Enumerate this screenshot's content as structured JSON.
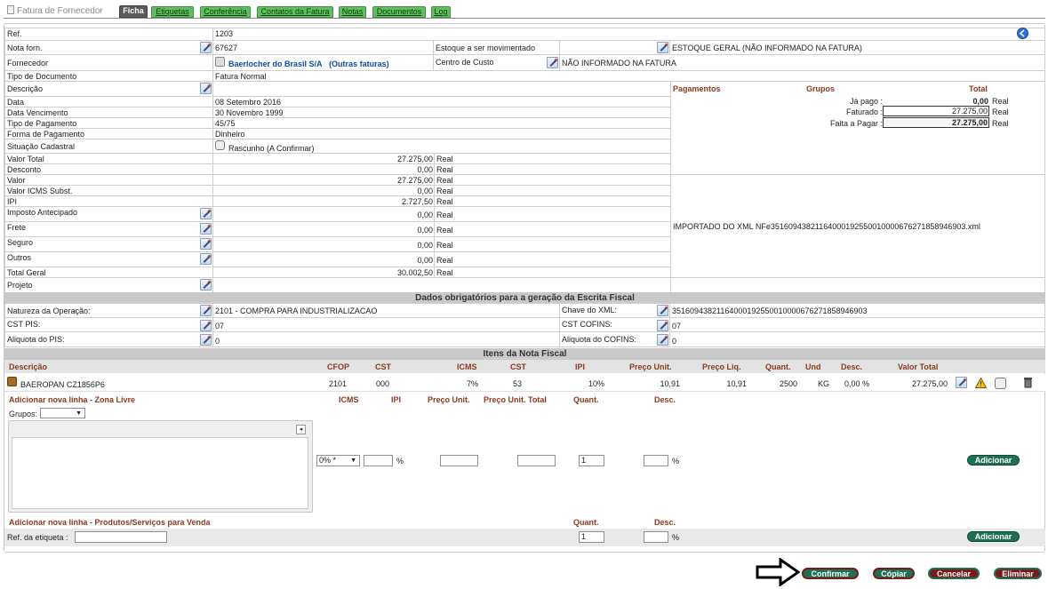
{
  "window": {
    "title": "Fatura de Fornecedor"
  },
  "tabs": [
    {
      "label": "Ficha"
    },
    {
      "label": "Etiquetas"
    },
    {
      "label": "Conferência"
    },
    {
      "label": "Contatos da Fatura"
    },
    {
      "label": "Notas"
    },
    {
      "label": "Documentos"
    },
    {
      "label": "Log"
    }
  ],
  "header": {
    "ref_label": "Ref.",
    "ref_value": "1203",
    "nota_label": "Nota forn.",
    "nota_value": "67627",
    "estoque_label": "Estoque a ser movimentado",
    "estoque_value": "ESTOQUE GERAL (NÃO INFORMADO NA FATURA)",
    "fornecedor_label": "Fornecedor",
    "fornecedor_value": "Baerlocher do Brasil S/A",
    "outras_faturas": "(Outras faturas)",
    "centro_label": "Centro de Custo",
    "centro_value": "NÃO INFORMADO NA FATURA",
    "tipo_doc_label": "Tipo de Documento",
    "tipo_doc_value": "Fatura Normal"
  },
  "details": {
    "descricao_label": "Descrição",
    "data_label": "Data",
    "data_value": "08 Setembro 2016",
    "venc_label": "Data Vencimento",
    "venc_value": "30 Novembro 1999",
    "tipo_pag_label": "Tipo de Pagamento",
    "tipo_pag_value": "45/75",
    "forma_pag_label": "Forma de Pagamento",
    "forma_pag_value": "Dinheiro",
    "situacao_label": "Situação Cadastral",
    "situacao_value": "Rascunho (A Confirmar)"
  },
  "values": [
    {
      "label": "Valor Total",
      "value": "27.275,00",
      "unit": "Real",
      "editable": false
    },
    {
      "label": "Desconto",
      "value": "0,00",
      "unit": "Real",
      "editable": false
    },
    {
      "label": "Valor",
      "value": "27.275,00",
      "unit": "Real",
      "editable": false
    },
    {
      "label": "Valor ICMS Subst.",
      "value": "0,00",
      "unit": "Real",
      "editable": false
    },
    {
      "label": "IPI",
      "value": "2.727,50",
      "unit": "Real",
      "editable": false
    },
    {
      "label": "Imposto Antecipado",
      "value": "0,00",
      "unit": "Real",
      "editable": true
    },
    {
      "label": "Frete",
      "value": "0,00",
      "unit": "Real",
      "editable": true
    },
    {
      "label": "Seguro",
      "value": "0,00",
      "unit": "Real",
      "editable": true
    },
    {
      "label": "Outros",
      "value": "0,00",
      "unit": "Real",
      "editable": true
    },
    {
      "label": "Total Geral",
      "value": "30.002,50",
      "unit": "Real",
      "editable": false
    }
  ],
  "projeto_label": "Projeto",
  "pagamentos": {
    "col1": "Pagamentos",
    "col2": "Grupos",
    "col3": "Total",
    "ja_pago_label": "Já pago :",
    "ja_pago_value": "0,00",
    "faturado_label": "Faturado :",
    "faturado_value": "27.275,00",
    "falta_label": "Falta a Pagar :",
    "falta_value": "27.275,00",
    "unit": "Real"
  },
  "import_note": "IMPORTADO DO XML NFe35160943821164000192550010000676271858946903.xml",
  "fiscal": {
    "title": "Dados obrigatórios para a geração da Escrita Fiscal",
    "natureza_label": "Natureza da Operação:",
    "natureza_value": "2101 - COMPRA PARA INDUSTRIALIZACAO",
    "chave_label": "Chave do XML:",
    "chave_value": "35160943821164000192550010000676271858946903",
    "cst_pis_label": "CST PIS:",
    "cst_pis_value": "07",
    "cst_cofins_label": "CST COFINS:",
    "cst_cofins_value": "07",
    "aliq_pis_label": "Aliquota do PIS:",
    "aliq_pis_value": "0",
    "aliq_cofins_label": "Aliquota do COFINS:",
    "aliq_cofins_value": "0"
  },
  "items": {
    "title": "Itens da Nota Fiscal",
    "columns": [
      "Descrição",
      "CFOP",
      "CST",
      "ICMS",
      "CST",
      "IPI",
      "Preço Unit.",
      "Preço Liq.",
      "Quant.",
      "Und",
      "Desc.",
      "Valor Total"
    ],
    "row": {
      "descricao": "BAEROPAN CZ1856P6",
      "cfop": "2101",
      "cst": "000",
      "icms": "7%",
      "cst2": "53",
      "ipi": "10%",
      "preco_unit": "10,91",
      "preco_liq": "10,91",
      "quant": "2500",
      "und": "KG",
      "desc": "0,00 %",
      "valor_total": "27.275,00"
    }
  },
  "add_free": {
    "title": "Adicionar nova linha - Zona Livre",
    "col_icms": "ICMS",
    "col_ipi": "IPI",
    "col_preco_unit": "Preço Unit.",
    "col_preco_total": "Preço Unit. Total",
    "col_quant": "Quant.",
    "col_desc": "Desc.",
    "grupos_label": "Grupos:",
    "icms_select": "0% *",
    "pct": "%",
    "quant_value": "1",
    "pct2": "%",
    "add_button": "Adicionar"
  },
  "add_products": {
    "title": "Adicionar nova linha - Produtos/Serviços para Venda",
    "col_quant": "Quant.",
    "col_desc": "Desc.",
    "ref_label": "Ref. da etiqueta :",
    "quant_value": "1",
    "pct": "%",
    "add_button": "Adicionar"
  },
  "actions": {
    "confirmar": "Confirmar",
    "copiar": "Cópiar",
    "cancelar": "Cancelar",
    "eliminar": "Eliminar"
  }
}
